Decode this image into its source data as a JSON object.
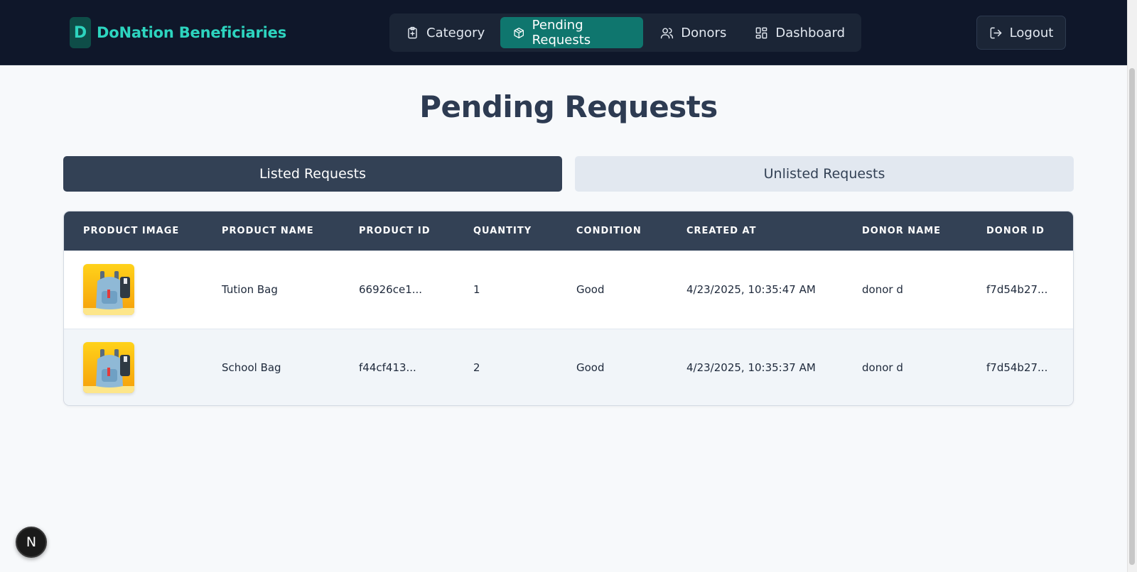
{
  "brand": {
    "logo_letter": "D",
    "name": "DoNation Beneficiaries"
  },
  "nav": {
    "items": [
      {
        "label": "Category",
        "icon": "clipboard-plus-icon",
        "active": false
      },
      {
        "label": "Pending Requests",
        "icon": "package-icon",
        "active": true
      },
      {
        "label": "Donors",
        "icon": "users-icon",
        "active": false
      },
      {
        "label": "Dashboard",
        "icon": "layout-grid-icon",
        "active": false
      }
    ],
    "logout_label": "Logout",
    "logout_icon": "log-out-icon"
  },
  "page": {
    "title": "Pending Requests"
  },
  "tabs": {
    "listed": "Listed Requests",
    "unlisted": "Unlisted Requests",
    "active": "listed"
  },
  "table": {
    "columns": [
      "PRODUCT IMAGE",
      "PRODUCT NAME",
      "PRODUCT ID",
      "QUANTITY",
      "CONDITION",
      "CREATED AT",
      "DONOR NAME",
      "DONOR ID"
    ],
    "rows": [
      {
        "product_image": "backpack-photo",
        "product_name": "Tution Bag",
        "product_id": "66926ce1...",
        "quantity": "1",
        "condition": "Good",
        "created_at": "4/23/2025, 10:35:47 AM",
        "donor_name": "donor d",
        "donor_id": "f7d54b27..."
      },
      {
        "product_image": "backpack-photo",
        "product_name": "School Bag",
        "product_id": "f44cf413...",
        "quantity": "2",
        "condition": "Good",
        "created_at": "4/23/2025, 10:35:37 AM",
        "donor_name": "donor d",
        "donor_id": "f7d54b27..."
      }
    ]
  },
  "badge": {
    "letter": "N"
  },
  "colors": {
    "header_bg": "#0f172a",
    "accent": "#0f766e",
    "brand_teal": "#2dd4bf",
    "table_header": "#334155"
  }
}
